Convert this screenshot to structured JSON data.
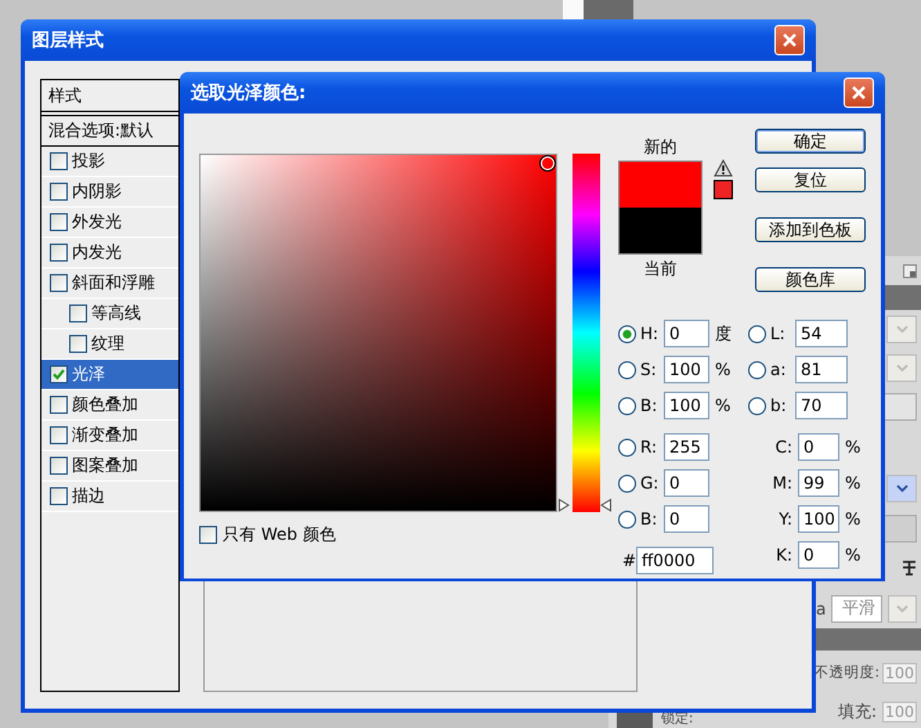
{
  "layer_style": {
    "title": "图层样式",
    "styles_header": "样式",
    "blending_options": "混合选项:默认",
    "effects": [
      {
        "label": "投影",
        "checked": false,
        "selected": false
      },
      {
        "label": "内阴影",
        "checked": false,
        "selected": false
      },
      {
        "label": "外发光",
        "checked": false,
        "selected": false
      },
      {
        "label": "内发光",
        "checked": false,
        "selected": false
      },
      {
        "label": "斜面和浮雕",
        "checked": false,
        "selected": false,
        "children": [
          {
            "label": "等高线",
            "checked": false,
            "selected": false
          },
          {
            "label": "纹理",
            "checked": false,
            "selected": false
          }
        ]
      },
      {
        "label": "光泽",
        "checked": true,
        "selected": true
      },
      {
        "label": "颜色叠加",
        "checked": false,
        "selected": false
      },
      {
        "label": "渐变叠加",
        "checked": false,
        "selected": false
      },
      {
        "label": "图案叠加",
        "checked": false,
        "selected": false
      },
      {
        "label": "描边",
        "checked": false,
        "selected": false
      }
    ]
  },
  "color_picker": {
    "title": "选取光泽颜色:",
    "hue_slider": {
      "level": 0
    },
    "field_marker": {
      "saturation": {
        "level": 1
      },
      "brightness": {
        "level": 1
      }
    },
    "web_only": {
      "label": "只有 Web 颜色",
      "checked": false
    },
    "swatches": [
      {
        "label": "新的",
        "color": "#ff0000"
      },
      {
        "label": "当前",
        "color": "#000000"
      }
    ],
    "buttons": [
      {
        "label": "确定",
        "default": true
      },
      {
        "label": "复位",
        "default": false
      },
      {
        "label": "添加到色板",
        "default": false
      },
      {
        "label": "颜色库",
        "default": false
      }
    ],
    "hsb_fields": [
      {
        "label": "H:",
        "value": "0",
        "unit": "度",
        "selected": true
      },
      {
        "label": "S:",
        "value": "100",
        "unit": "%",
        "selected": false
      },
      {
        "label": "B:",
        "value": "100",
        "unit": "%",
        "selected": false
      }
    ],
    "rgb_fields": [
      {
        "label": "R:",
        "value": "255",
        "selected": false
      },
      {
        "label": "G:",
        "value": "0",
        "selected": false
      },
      {
        "label": "B:",
        "value": "0",
        "selected": false
      }
    ],
    "hex": {
      "label": "#",
      "value": "ff0000"
    },
    "lab_fields": [
      {
        "label": "L:",
        "value": "54",
        "selected": false
      },
      {
        "label": "a:",
        "value": "81",
        "selected": false
      },
      {
        "label": "b:",
        "value": "70",
        "selected": false
      }
    ],
    "cmyk_fields": [
      {
        "label": "C:",
        "value": "0",
        "unit": "%"
      },
      {
        "label": "M:",
        "value": "99",
        "unit": "%"
      },
      {
        "label": "Y:",
        "value": "100",
        "unit": "%"
      },
      {
        "label": "K:",
        "value": "0",
        "unit": "%"
      }
    ]
  },
  "side_panel": {
    "aa_label": "a",
    "smoothing": "平滑",
    "opacity_label": "不透明度:",
    "opacity_value": "100",
    "lock_label": "锁定:",
    "fill_label": "填充:",
    "fill_value": "100"
  }
}
